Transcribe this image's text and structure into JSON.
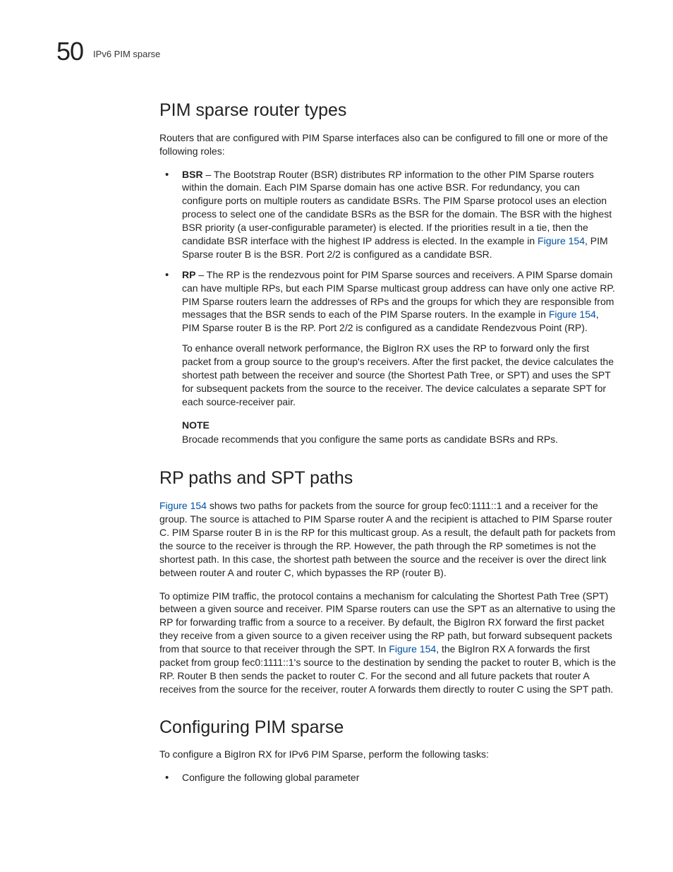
{
  "header": {
    "chapter_number": "50",
    "chapter_title": "IPv6 PIM sparse"
  },
  "section1": {
    "heading": "PIM sparse router types",
    "intro": "Routers that are configured with PIM Sparse interfaces also can be configured to fill one or more of the following roles:",
    "bsr_term": "BSR",
    "bsr_text_before_link": " – The Bootstrap Router (BSR) distributes RP information to the other PIM Sparse routers within the domain. Each PIM Sparse domain has one active BSR. For redundancy, you can configure ports on multiple routers as candidate BSRs. The PIM Sparse protocol uses an election process to select one of the candidate BSRs as the BSR for the domain. The BSR with the highest BSR priority (a user-configurable parameter) is elected. If the priorities result in a tie, then the candidate BSR interface with the highest IP address is elected. In the example in ",
    "bsr_link": "Figure 154",
    "bsr_text_after_link": ", PIM Sparse router B is the BSR.  Port 2/2 is configured as a candidate BSR.",
    "rp_term": "RP",
    "rp_text_before_link": " – The RP is the rendezvous point for PIM Sparse sources and receivers. A PIM Sparse domain can have multiple RPs, but each PIM Sparse multicast group address can have only one active RP.  PIM Sparse routers learn the addresses of RPs and the groups for which they are responsible from messages that the BSR sends to each of the PIM Sparse routers.  In the example in ",
    "rp_link": "Figure 154",
    "rp_text_after_link": ", PIM Sparse router B is the RP.  Port 2/2 is configured as a candidate Rendezvous Point (RP).",
    "spt_para": "To enhance overall network performance, the BigIron RX uses the RP to forward only the first packet  from a group source to the group's receivers.  After the first packet, the device calculates the shortest path between the receiver and source (the Shortest Path Tree, or SPT) and uses the SPT for subsequent packets from the source to the receiver.  The device calculates a separate SPT for each source-receiver pair.",
    "note_label": "NOTE",
    "note_text": "Brocade recommends that you configure the same ports as candidate BSRs and RPs."
  },
  "section2": {
    "heading": "RP paths and SPT paths",
    "p1_link": "Figure 154",
    "p1_after": " shows two paths for packets from the source for group fec0:1111::1 and a receiver for the group.  The source is attached to PIM Sparse router A and the recipient is attached to PIM Sparse router C.  PIM Sparse router B in is the RP for this multicast group.  As a result, the default path for packets from the source to the receiver is through the RP.  However, the path through the RP sometimes is not the shortest path.  In this case, the shortest path between the source and the receiver is over the direct link between router A and router C, which bypasses the RP (router B).",
    "p2_before": "To optimize PIM traffic, the protocol contains a mechanism for calculating the Shortest Path Tree (SPT) between a given source and receiver.  PIM Sparse routers can use the SPT as an alternative to using the RP for forwarding traffic from a source to a receiver.  By default, the  BigIron RX forward the first packet they receive from a given source to a given receiver using the RP path, but forward subsequent packets from that source to that receiver through the SPT.  In ",
    "p2_link": "Figure 154",
    "p2_after": ", the BigIron RX A forwards the first packet from group fec0:1111::1's source to the destination by sending the packet to router B, which is the RP.  Router B then sends the packet to router C.  For the second and all future packets that router A receives from the source for the receiver, router A forwards them directly to router C using the SPT path."
  },
  "section3": {
    "heading": "Configuring PIM sparse",
    "intro": "To configure a BigIron RX for IPv6 PIM Sparse, perform the following tasks:",
    "bullet1": "Configure the following global parameter"
  }
}
